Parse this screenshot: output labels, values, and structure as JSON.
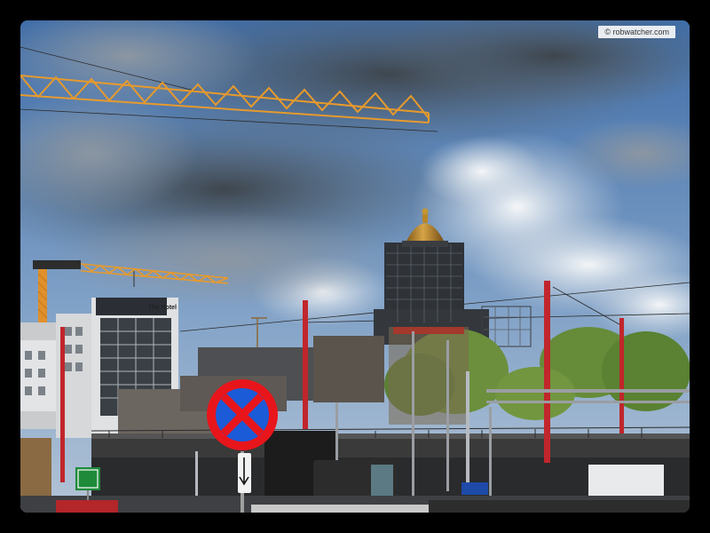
{
  "photo": {
    "watermark": "© robwatcher.com",
    "building_sign": "The Hotel"
  },
  "colors": {
    "sky_top": "#3f6da8",
    "sky_bottom": "#9fb9d6",
    "cloud_dark": "#4a5560",
    "cloud_light": "#e8ecef",
    "crane": "#e79a2c",
    "dome_gold": "#b8862a",
    "scaffold": "#3c3e42",
    "trees": "#5f8a3a",
    "sign_red": "#e8151b",
    "sign_blue": "#1c5bd8",
    "catenary_red": "#c0262b",
    "frame_border": "#000000"
  }
}
